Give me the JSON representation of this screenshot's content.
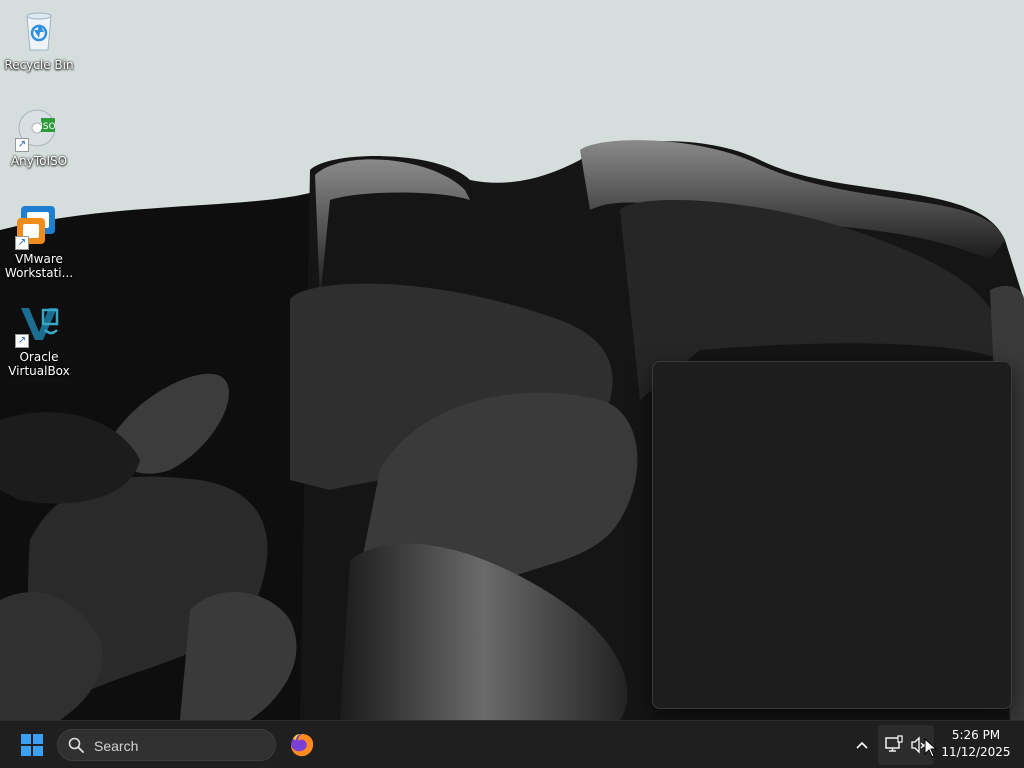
{
  "desktop": {
    "icons": [
      {
        "label": "Recycle Bin",
        "icon": "recycle-bin-icon"
      },
      {
        "label": "AnyToISO",
        "icon": "anytoiso-icon"
      },
      {
        "label": "VMware Workstati...",
        "icon": "vmware-workstation-icon"
      },
      {
        "label": "Oracle VirtualBox",
        "icon": "virtualbox-icon"
      }
    ]
  },
  "taskbar": {
    "search_placeholder": "Search",
    "pinned_apps": [
      {
        "icon": "firefox-icon"
      }
    ],
    "clock": {
      "time": "5:26 PM",
      "date": "11/12/2025"
    }
  },
  "colors": {
    "taskbar_bg": "#1f1f1f",
    "start_accent": "#3aa0f3",
    "flyout_bg": "#1d1d1d"
  }
}
